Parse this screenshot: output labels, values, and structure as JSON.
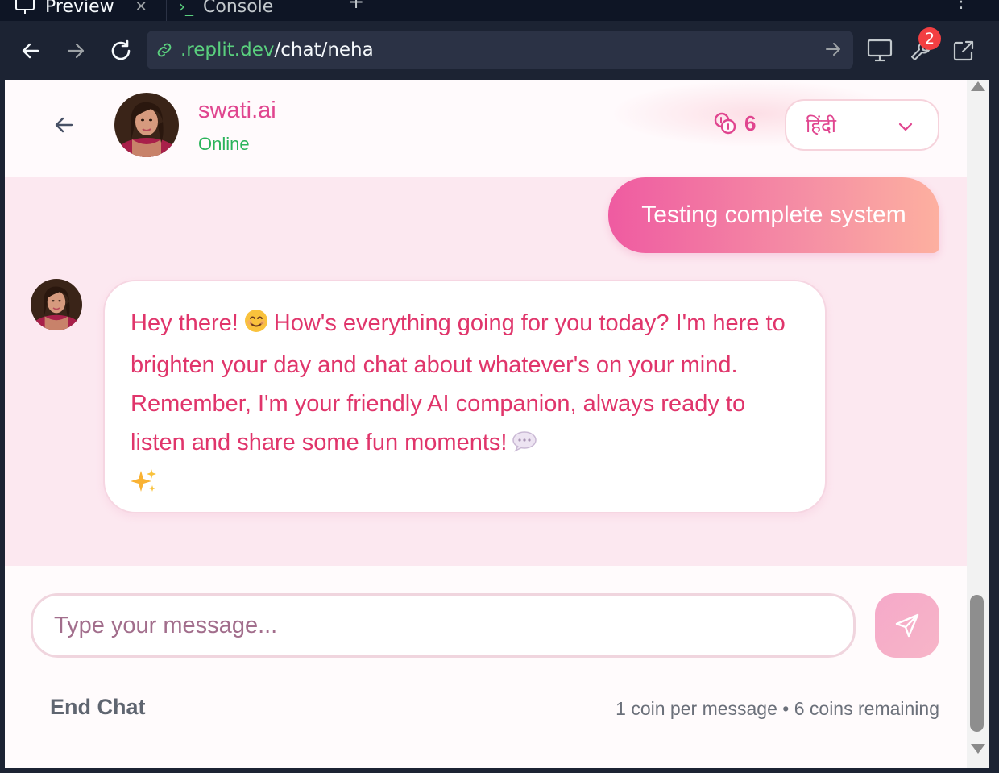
{
  "browser": {
    "tabs": [
      {
        "label": "Preview",
        "close": "✕"
      },
      {
        "label": "Console"
      }
    ],
    "add_tab": "+",
    "more": "⋮",
    "url_domain": ".replit.dev",
    "url_path": "/chat/neha",
    "badge_count": "2"
  },
  "chat": {
    "bot_name": "swati.ai",
    "status": "Online",
    "coins": "6",
    "language": "हिंदी",
    "user_message": "Testing complete system",
    "bot_message_line1": "Hey there!",
    "bot_message_line1b": "How's everything going for you today? I'm here to brighten your day and chat about whatever's on your mind. Remember, I'm your friendly AI companion, always ready to listen and share some fun moments!",
    "input_placeholder": "Type your message...",
    "end_chat": "End Chat",
    "coin_info": "1 coin per message • 6 coins remaining"
  },
  "colors": {
    "accent": "#e0458f",
    "online": "#2ab35a",
    "chat_bg": "#fce8f0"
  },
  "icons": [
    "back-arrow-icon",
    "coins-icon",
    "chevron-down-icon",
    "send-icon",
    "link-icon",
    "monitor-icon",
    "wrench-icon",
    "external-link-icon"
  ]
}
